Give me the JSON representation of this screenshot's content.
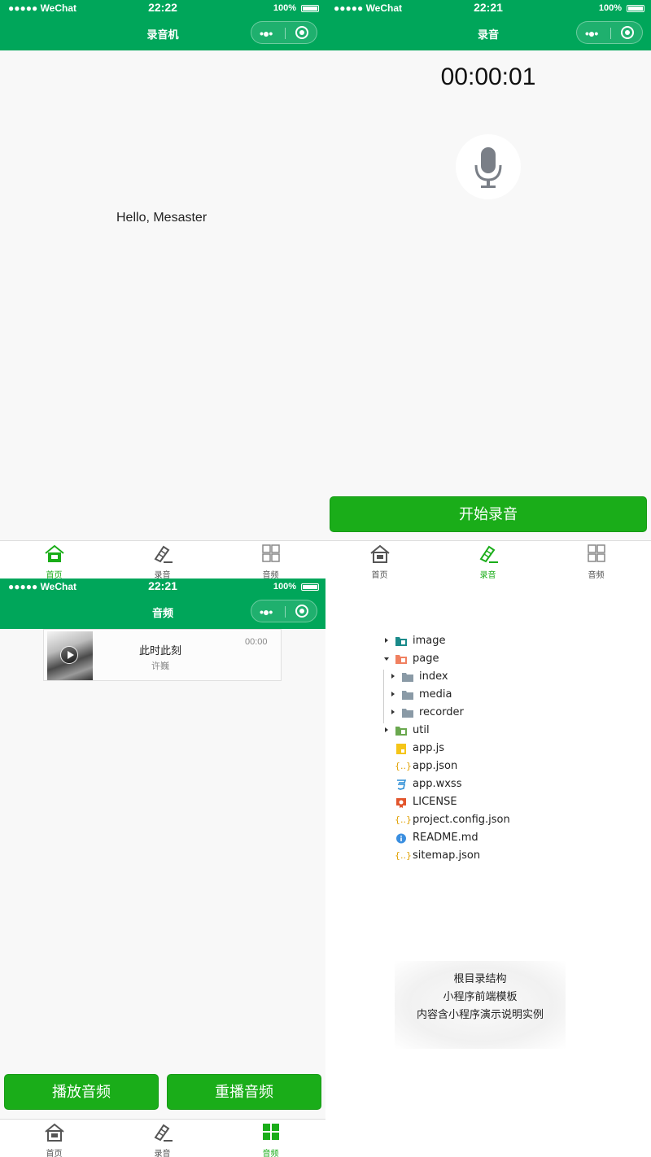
{
  "status_bar": {
    "signal": "●●●●● WeChat",
    "battery": "100%",
    "times": [
      "22:22",
      "22:21",
      "22:21"
    ]
  },
  "screen_home": {
    "nav_title": "录音机",
    "greeting": "Hello, Mesaster"
  },
  "screen_recorder": {
    "nav_title": "录音",
    "timer": "00:00:01",
    "mic_icon": "microphone-icon",
    "start_button": "开始录音"
  },
  "screen_audio": {
    "nav_title": "音频",
    "player": {
      "song_name": "此时此刻",
      "author": "许巍",
      "time": "00:00"
    },
    "play_button": "播放音频",
    "replay_button": "重播音频"
  },
  "tabs": [
    {
      "label": "首页",
      "icon": "home-icon"
    },
    {
      "label": "录音",
      "icon": "recorder-icon"
    },
    {
      "label": "音频",
      "icon": "grid-icon"
    }
  ],
  "file_tree": [
    {
      "name": "image",
      "type": "folder",
      "icon": "image-folder-icon",
      "level": 0,
      "expandable": true
    },
    {
      "name": "page",
      "type": "folder",
      "icon": "page-folder-icon",
      "level": 0,
      "expanded": true
    },
    {
      "name": "index",
      "type": "folder",
      "icon": "folder-icon",
      "level": 1,
      "expandable": true
    },
    {
      "name": "media",
      "type": "folder",
      "icon": "folder-icon",
      "level": 1,
      "expandable": true
    },
    {
      "name": "recorder",
      "type": "folder",
      "icon": "folder-icon",
      "level": 1,
      "expandable": true
    },
    {
      "name": "util",
      "type": "folder",
      "icon": "util-folder-icon",
      "level": 0,
      "expandable": true
    },
    {
      "name": "app.js",
      "type": "file",
      "icon": "js-file-icon",
      "level": 0
    },
    {
      "name": "app.json",
      "type": "file",
      "icon": "json-file-icon",
      "level": 0
    },
    {
      "name": "app.wxss",
      "type": "file",
      "icon": "css-file-icon",
      "level": 0
    },
    {
      "name": "LICENSE",
      "type": "file",
      "icon": "license-file-icon",
      "level": 0
    },
    {
      "name": "project.config.json",
      "type": "file",
      "icon": "json-file-icon",
      "level": 0
    },
    {
      "name": "README.md",
      "type": "file",
      "icon": "info-file-icon",
      "level": 0
    },
    {
      "name": "sitemap.json",
      "type": "file",
      "icon": "json-file-icon",
      "level": 0
    }
  ],
  "caption": {
    "line1": "根目录结构",
    "line2": "小程序前端模板",
    "line3": "内容含小程序演示说明实例"
  },
  "colors": {
    "nav_green": "#00a65a",
    "button_green": "#1aad19",
    "tab_active": "#1aad19"
  }
}
